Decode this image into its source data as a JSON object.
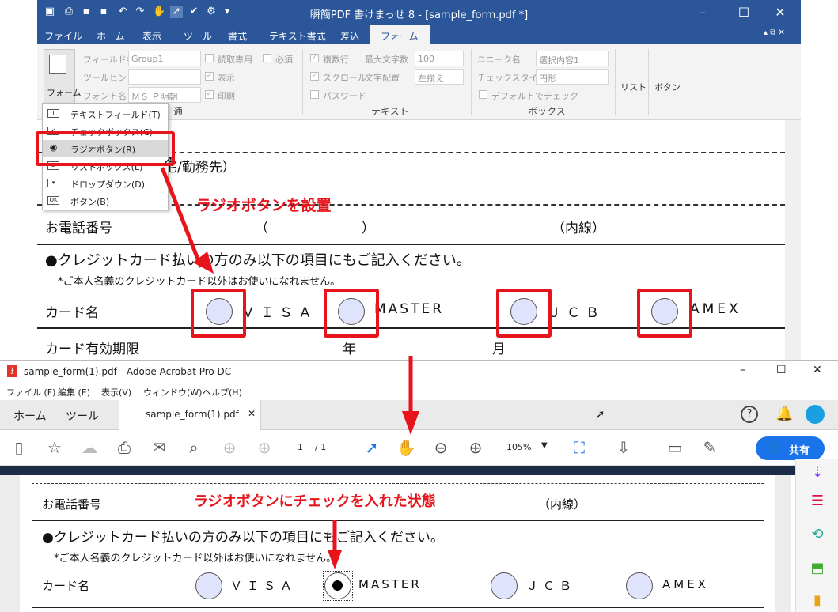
{
  "top_app": {
    "title": "瞬簡PDF 書けまっせ 8 - [sample_form.pdf *]",
    "menu_tabs": [
      "ファイル",
      "ホーム",
      "表示",
      "ツール",
      "書式",
      "テキスト書式",
      "差込",
      "フォーム"
    ],
    "form_button": "フォーム",
    "fields": {
      "field_name_label": "フィールド名",
      "field_name_value": "Group1",
      "tooltip_label": "ツールヒント",
      "font_label": "フォント名",
      "font_value": "ＭＳ Ｐ明朝",
      "readonly": "読取専用",
      "required": "必須",
      "display": "表示",
      "print": "印刷",
      "multiline": "複数行",
      "scroll": "スクロール",
      "password": "パスワード",
      "max_chars_label": "最大文字数",
      "max_chars_value": "100",
      "align_label": "文字配置",
      "align_value": "左揃え",
      "unique_label": "ユニーク名",
      "unique_value": "選択内容1",
      "checkstyle_label": "チェックスタイル",
      "checkstyle_value": "円形",
      "default_check": "デフォルトでチェック",
      "list": "リスト",
      "button": "ボタン"
    },
    "group_labels": {
      "common": "通",
      "text": "テキスト",
      "box": "ボックス"
    },
    "dropdown": [
      {
        "icon": "T",
        "label": "テキストフィールド(T)"
      },
      {
        "icon": "✓",
        "label": "チェックボックス(C)"
      },
      {
        "icon": "◉",
        "label": "ラジオボタン(R)"
      },
      {
        "icon": "≣",
        "label": "リストボックス(L)"
      },
      {
        "icon": "▾",
        "label": "ドロップダウン(D)"
      },
      {
        "icon": "OK",
        "label": "ボタン(B)"
      }
    ],
    "doc": {
      "workplace": "宅/勤務先）",
      "phone": "お電話番号",
      "paren_open": "（",
      "paren_close": "）",
      "ext": "（内線）",
      "credit_note": "●クレジットカード払いの方のみ以下の項目にもご記入ください。",
      "credit_sub": "*ご本人名義のクレジットカード以外はお使いになれません。",
      "card_name": "カード名",
      "cards": [
        "ＶＩＳＡ",
        "MASTER",
        "ＪＣＢ",
        "AMEX"
      ],
      "expiry": "カード有効期限",
      "year": "年",
      "month": "月"
    }
  },
  "annotations": {
    "set_radio": "ラジオボタンを設置",
    "checked_state": "ラジオボタンにチェックを入れた状態"
  },
  "acrobat": {
    "title": "sample_form(1).pdf - Adobe Acrobat Pro DC",
    "menu": [
      "ファイル (F)",
      "編集 (E)",
      "表示(V)",
      "ウィンドウ(W)",
      "ヘルプ(H)"
    ],
    "tabs": [
      "ホーム",
      "ツール"
    ],
    "doc_tab": "sample_form(1).pdf",
    "page_current": "1",
    "page_total": "/ 1",
    "zoom": "105%",
    "share": "共有",
    "doc": {
      "phone": "お電話番号",
      "ext": "（内線）",
      "credit_note": "●クレジットカード払いの方のみ以下の項目にもご記入ください。",
      "credit_sub": "*ご本人名義のクレジットカード以外はお使いになれません。",
      "card_name": "カード名",
      "cards": [
        "ＶＩＳＡ",
        "MASTER",
        "ＪＣＢ",
        "AMEX"
      ],
      "selected_card_index": 1
    }
  }
}
